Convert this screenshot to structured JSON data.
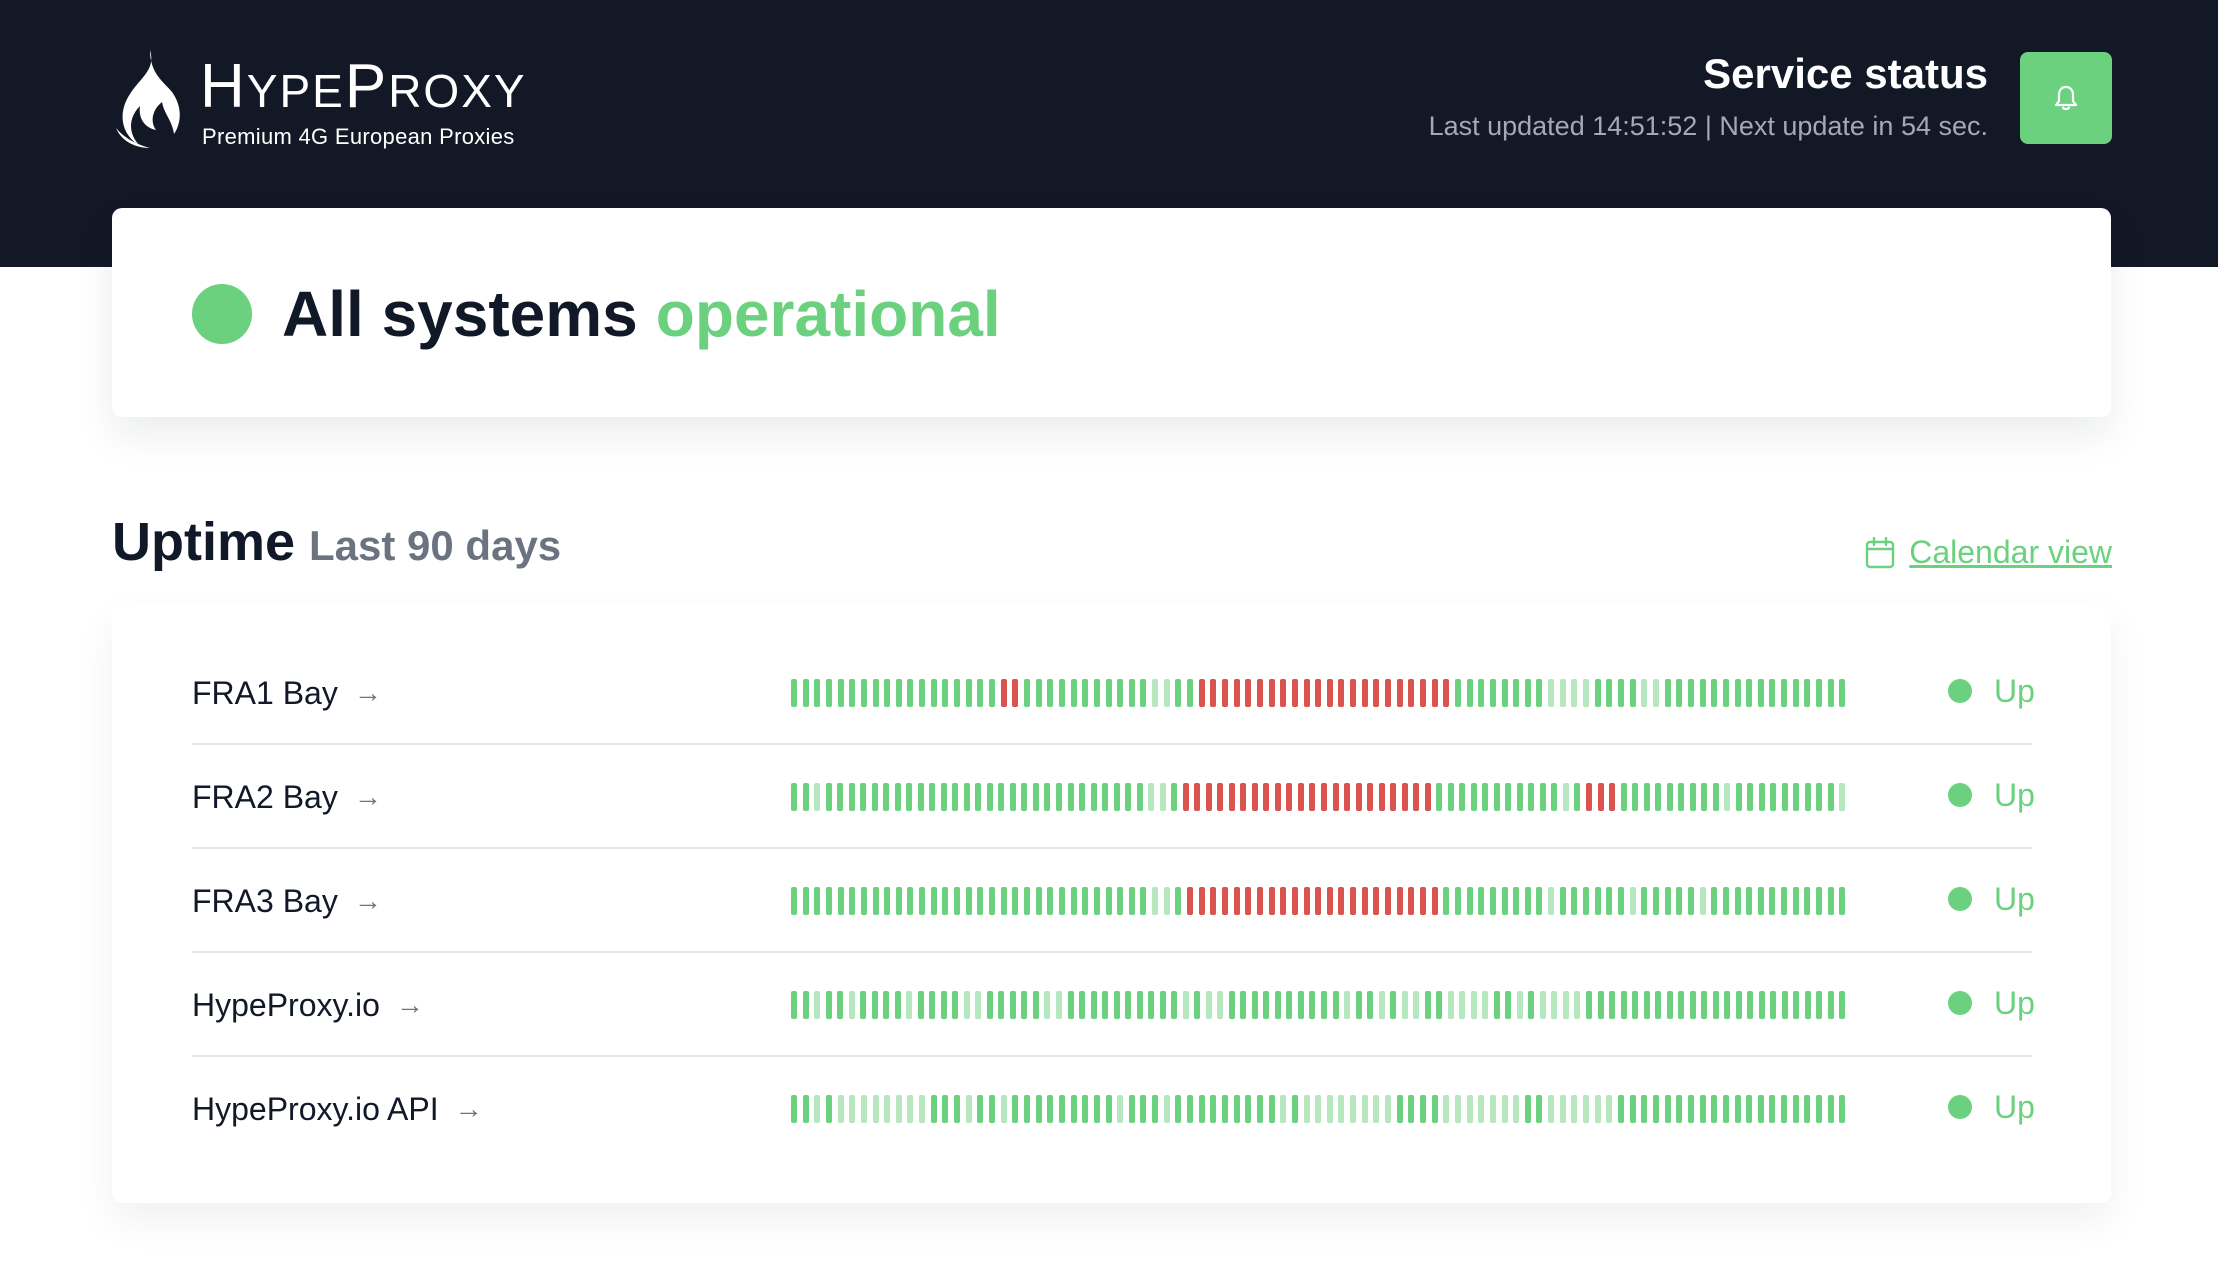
{
  "colors": {
    "dark_header": "#121826",
    "accent_green": "#6bd17e",
    "bar_up": "#6bd17e",
    "bar_partial": "#b7e7bf",
    "bar_down": "#d9534f",
    "muted_text": "#6b7280"
  },
  "brand": {
    "name_first": "H",
    "name_rest1": "YPE",
    "name_mid": "P",
    "name_rest2": "ROXY",
    "tagline": "Premium 4G European Proxies",
    "logo_icon": "flame-icon"
  },
  "header": {
    "title": "Service status",
    "subtitle": "Last updated 14:51:52 | Next update in 54 sec.",
    "bell_icon": "bell-icon"
  },
  "overall": {
    "prefix": "All systems",
    "state": "operational"
  },
  "uptime": {
    "title": "Uptime",
    "period": "Last 90 days",
    "calendar_link": "Calendar view"
  },
  "services": [
    {
      "name": "FRA1 Bay",
      "status": "Up",
      "days": "UUUUUUUUUUUUUUUUUUDDUUUUUUUUUUUPPUUDDDDDDDDDDDDDDDDDDDDDDUUUUUUUUPPPPUUUUPPUUUUUUUUUUUUUUUU"
    },
    {
      "name": "FRA2 Bay",
      "status": "Up",
      "days": "UUPUUUUUUUUUUUUUUUUUUUUUUUUUUUUPPUDDDDDDDDDDDDDDDDDDDDDDUUUUUUUUUUUPUDDDUUUUUUUUUPUUUUUUUUUP"
    },
    {
      "name": "FRA3 Bay",
      "status": "Up",
      "days": "UUUUUUUUUUUUUUUUUUUUUUUUUUUUUUUPPUDDDDDDDDDDDDDDDDDDDDDDUUUUUUUUUPUUUUUUPUUUUUPUUUUUUUUUUUU"
    },
    {
      "name": "HypeProxy.io",
      "status": "Up",
      "days": "UUPUUPUUUUPUUUUPPUUUUUPPUUUUUUUUUUPUPPUUUUUUUUUUPUUPUPPUUPPPPUUPUPPPPUUUUUUUUUUUUUUUUUUUUUUU"
    },
    {
      "name": "HypeProxy.io API",
      "status": "Up",
      "days": "UUPUPPPPPPPPUUUPUUPUUUUUUUUUPUUUPUUUUUUUUUPUPPPPPPPPUUUUPPPPPPPUUPPPPPPUUUUUUUUUUUUUUUUUUUU"
    }
  ]
}
